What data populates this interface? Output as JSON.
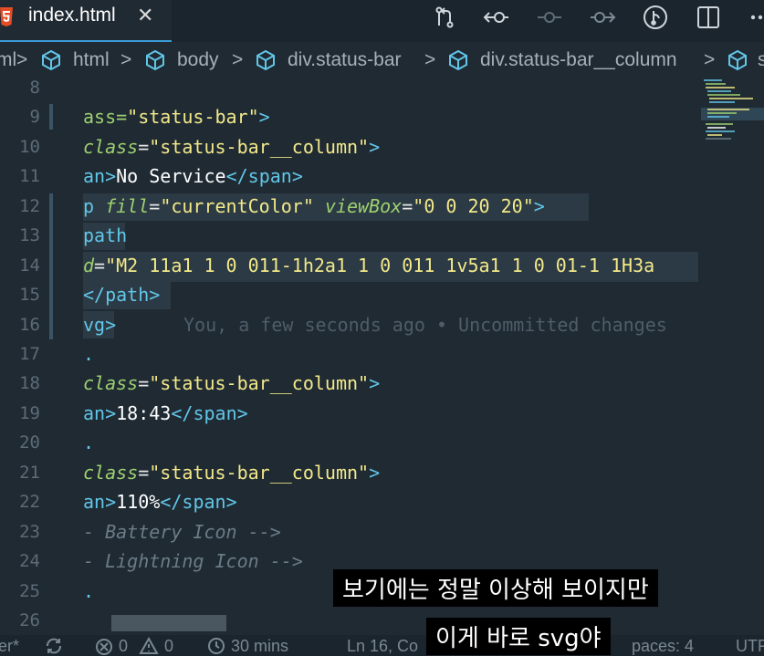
{
  "tab": {
    "title": "index.html",
    "close": "✕"
  },
  "toolbar": {
    "icons": [
      "source-control-compare-icon",
      "timeline-back-icon",
      "timeline-point-icon",
      "timeline-forward-icon",
      "branch-graph-icon",
      "split-editor-icon",
      "more-actions-icon"
    ]
  },
  "breadcrumb": {
    "items": [
      "ml",
      "html",
      "body",
      "div.status-bar",
      "div.status-bar__column",
      "s"
    ],
    "separator": ">"
  },
  "editor": {
    "line_numbers": [
      "8",
      "9",
      "10",
      "11",
      "12",
      "13",
      "14",
      "15",
      "16",
      "17",
      "18",
      "19",
      "20",
      "21",
      "22",
      "23",
      "24",
      "25",
      "26"
    ],
    "lines": {
      "l9": [
        "ass=",
        "\"status-bar\"",
        ">"
      ],
      "l10": [
        "class",
        "=",
        "\"status-bar__column\"",
        ">"
      ],
      "l11": [
        "an",
        ">",
        "No Service",
        "</",
        "span",
        ">"
      ],
      "l12": [
        "p",
        " ",
        "fill",
        "=",
        "\"currentColor\"",
        " ",
        "viewBox",
        "=",
        "\"0 0 20 20\"",
        ">"
      ],
      "l13": [
        "path"
      ],
      "l14": [
        "d",
        "=",
        "\"M2 11a1 1 0 011-1h2a1 1 0 011 1v5a1 1 0 01-1 1H3a"
      ],
      "l15": [
        "</",
        "path",
        ">"
      ],
      "l16": [
        "vg",
        ">"
      ],
      "l17": [
        "."
      ],
      "l18": [
        "class",
        "=",
        "\"status-bar__column\"",
        ">"
      ],
      "l19": [
        "an",
        ">",
        "18:43",
        "</",
        "span",
        ">"
      ],
      "l20": [
        "."
      ],
      "l21": [
        "class",
        "=",
        "\"status-bar__column\"",
        ">"
      ],
      "l22": [
        "an",
        ">",
        "110%",
        "</",
        "span",
        ">"
      ],
      "l23": [
        "- Battery Icon -->"
      ],
      "l24": [
        "- Lightning Icon -->"
      ],
      "l25": [
        "."
      ]
    },
    "blame": "You, a few seconds ago • Uncommitted changes"
  },
  "statusbar": {
    "branch": "er*",
    "errors": "0",
    "warnings": "0",
    "time_spent": "30 mins",
    "cursor": "Ln 16, Co",
    "spaces": "paces: 4",
    "encoding": "UTF"
  },
  "subtitles": {
    "line1": "보기에는 정말 이상해 보이지만",
    "line2": "이게 바로 svg야"
  }
}
